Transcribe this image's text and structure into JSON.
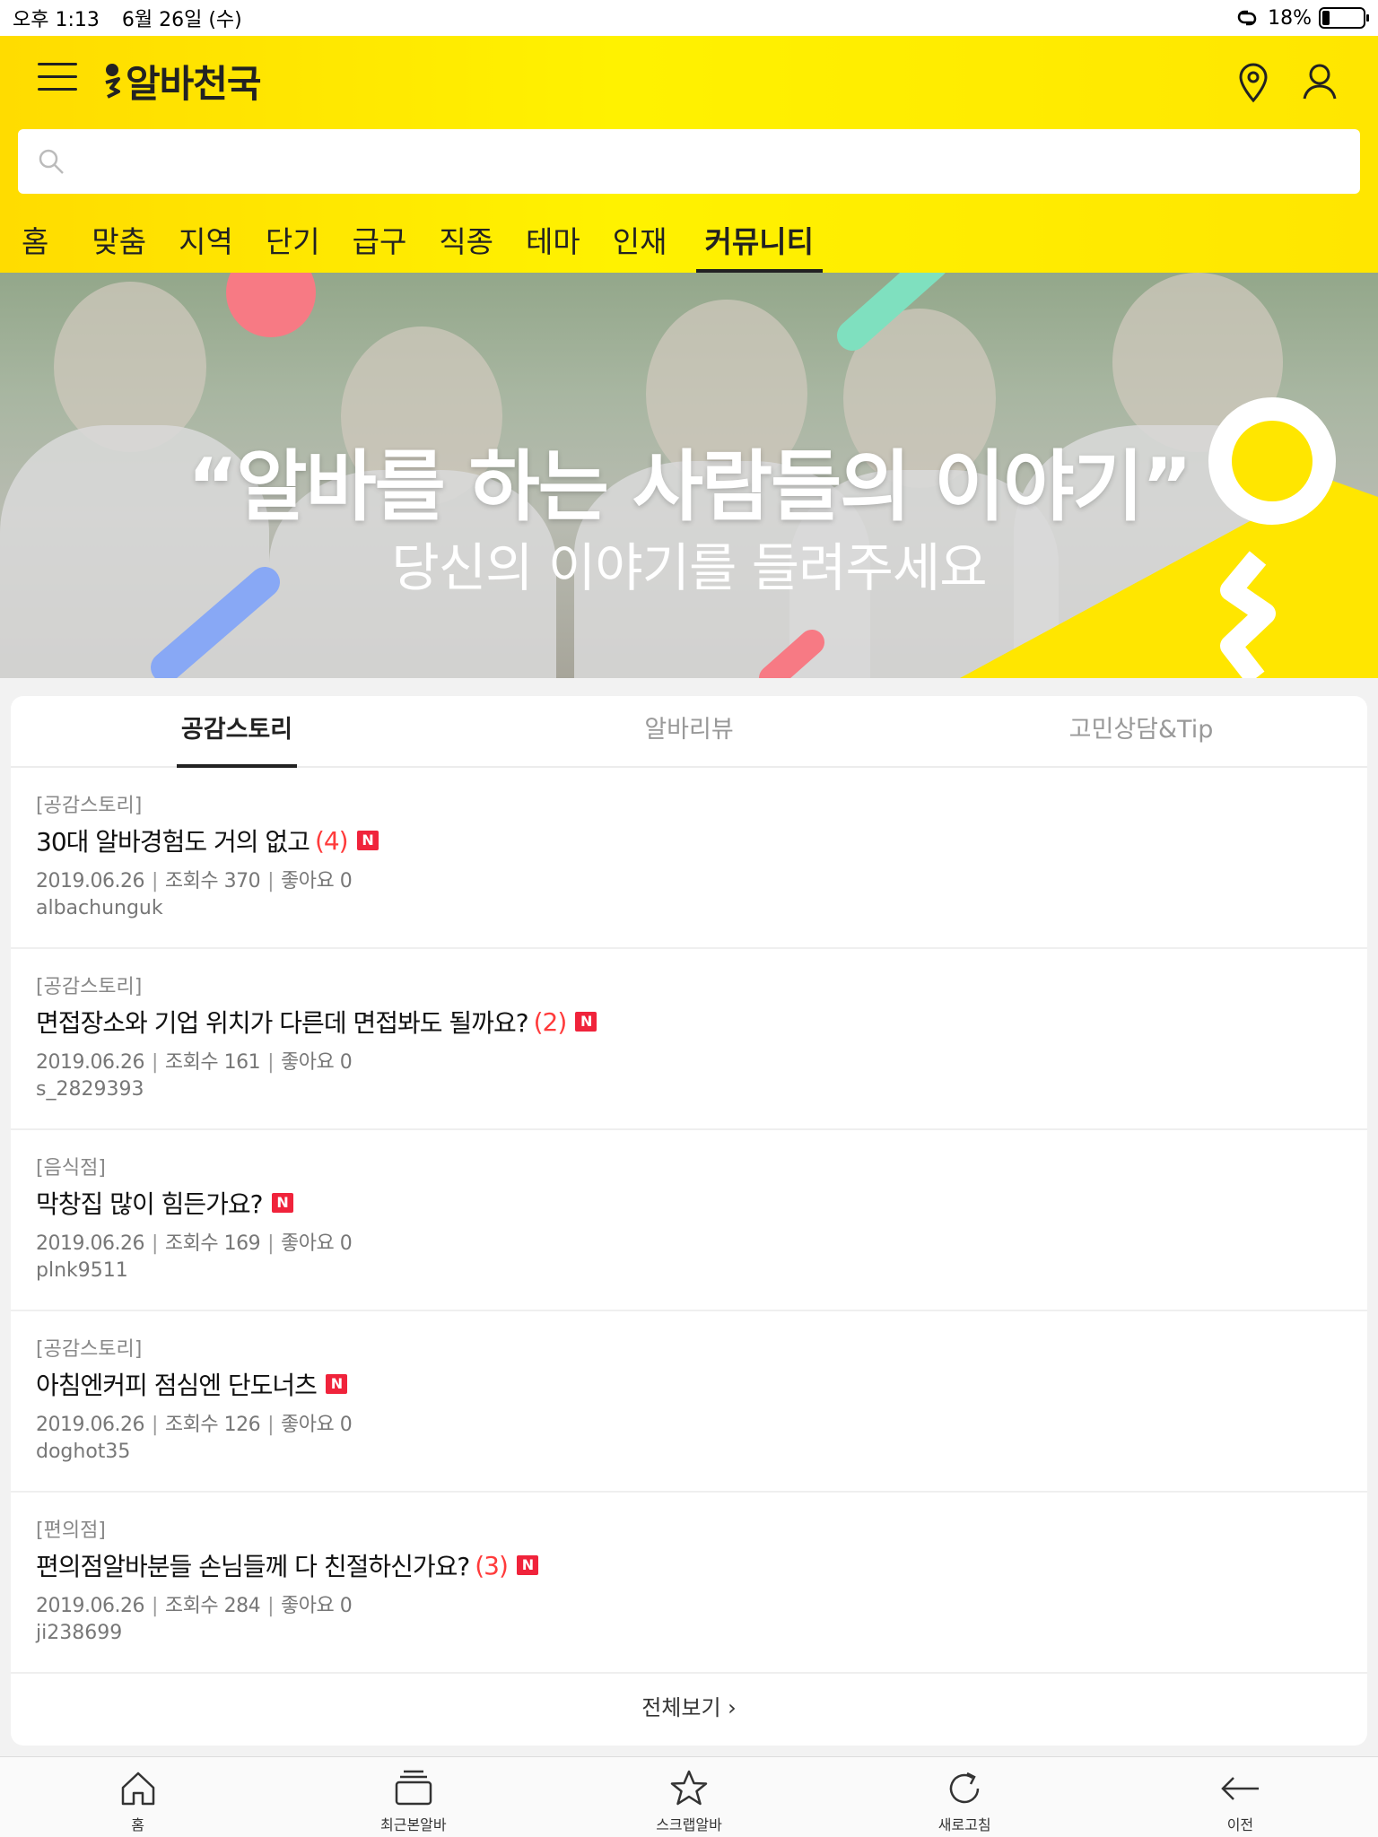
{
  "status_bar": {
    "time": "오후 1:13",
    "date": "6월 26일 (수)",
    "battery": "18%",
    "battery_level": 0.18
  },
  "header": {
    "logo_text": "알바천국",
    "search_placeholder": "",
    "nav": [
      {
        "label": "홈"
      },
      {
        "label": "맞춤"
      },
      {
        "label": "지역"
      },
      {
        "label": "단기"
      },
      {
        "label": "급구"
      },
      {
        "label": "직종"
      },
      {
        "label": "테마"
      },
      {
        "label": "인재"
      },
      {
        "label": "커뮤니티",
        "active": true
      }
    ],
    "accent_color": "#ffe600"
  },
  "banner": {
    "title": "“알바를 하는 사람들의 이야기”",
    "subtitle": "당신의 이야기를 들려주세요"
  },
  "community": {
    "tabs": [
      {
        "label": "공감스토리",
        "active": true
      },
      {
        "label": "알바리뷰"
      },
      {
        "label": "고민상담&Tip"
      }
    ],
    "posts": [
      {
        "category": "[공감스토리]",
        "title": "30대 알바경험도 거의 없고",
        "comments": "(4)",
        "new_badge": "N",
        "date": "2019.06.26",
        "views": "조회수 370",
        "likes": "좋아요 0",
        "author": "albachunguk"
      },
      {
        "category": "[공감스토리]",
        "title": "면접장소와 기업 위치가 다른데 면접봐도 될까요?",
        "comments": "(2)",
        "new_badge": "N",
        "date": "2019.06.26",
        "views": "조회수 161",
        "likes": "좋아요 0",
        "author": "s_2829393"
      },
      {
        "category": "[음식점]",
        "title": "막창집 많이 힘든가요?",
        "comments": "",
        "new_badge": "N",
        "date": "2019.06.26",
        "views": "조회수 169",
        "likes": "좋아요 0",
        "author": "plnk9511"
      },
      {
        "category": "[공감스토리]",
        "title": "아침엔커피 점심엔 단도너츠",
        "comments": "",
        "new_badge": "N",
        "date": "2019.06.26",
        "views": "조회수 126",
        "likes": "좋아요 0",
        "author": "doghot35"
      },
      {
        "category": "[편의점]",
        "title": "편의점알바분들 손님들께 다 친절하신가요?",
        "comments": "(3)",
        "new_badge": "N",
        "date": "2019.06.26",
        "views": "조회수 284",
        "likes": "좋아요 0",
        "author": "ji238699"
      }
    ],
    "view_all": "전체보기 ›"
  },
  "bottom_bar": [
    {
      "label": "홈",
      "icon": "home-icon"
    },
    {
      "label": "최근본알바",
      "icon": "stack-icon"
    },
    {
      "label": "스크랩알바",
      "icon": "star-icon"
    },
    {
      "label": "새로고침",
      "icon": "refresh-icon"
    },
    {
      "label": "이전",
      "icon": "back-arrow-icon"
    }
  ]
}
